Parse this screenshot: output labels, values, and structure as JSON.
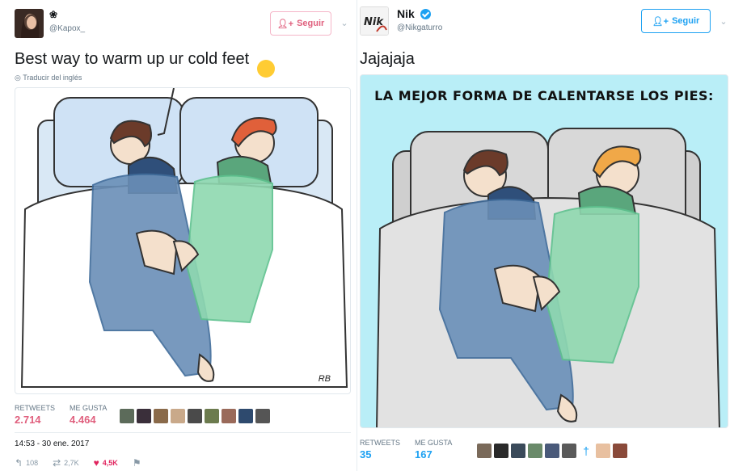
{
  "left_tweet": {
    "display_name": "❀",
    "handle": "@Kapox_",
    "follow_label": "Seguir",
    "text": "Best way to warm up ur cold feet",
    "emoji": "🙃",
    "translate_label": "Traducir del inglés",
    "comic_signature": "RB",
    "stats": {
      "retweets_label": "RETWEETS",
      "retweets_value": "2.714",
      "likes_label": "ME GUSTA",
      "likes_value": "4.464"
    },
    "timestamp": "14:53 - 30 ene. 2017",
    "actions": {
      "reply_count": "108",
      "retweet_count": "2,7K",
      "like_count": "4,5K"
    }
  },
  "right_tweet": {
    "display_name": "Nik",
    "handle": "@Nikgaturro",
    "follow_label": "Seguir",
    "text": "Jajajaja",
    "comic_title": "LA MEJOR FORMA DE CALENTARSE LOS PIES:",
    "stats": {
      "retweets_label": "RETWEETS",
      "retweets_value": "35",
      "likes_label": "ME GUSTA",
      "likes_value": "167"
    }
  },
  "colors": {
    "twitter_blue": "#1da1f2",
    "like_pink": "#e0607e",
    "comic_bg_right": "#b9eef7",
    "man_pajama_blue": "#6a8fb8",
    "woman_pajama_green": "#8fd9b0"
  },
  "icons": {
    "follow": "person-plus-icon",
    "chevron": "chevron-down-icon",
    "verified": "verified-badge-icon",
    "translate": "globe-icon",
    "reply": "reply-icon",
    "retweet": "retweet-icon",
    "like": "heart-icon",
    "more": "flag-icon"
  }
}
